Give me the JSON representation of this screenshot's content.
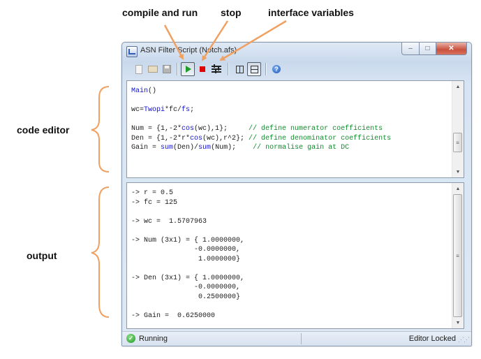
{
  "annotations": {
    "compile_and_run": "compile and run",
    "stop": "stop",
    "interface_variables": "interface variables",
    "code_editor": "code editor",
    "output": "output"
  },
  "window": {
    "title": "ASN Filter Script (Notch.afs)",
    "min_glyph": "–",
    "max_glyph": "□",
    "close_glyph": "✕"
  },
  "toolbar": {
    "help_glyph": "?"
  },
  "code_lines": [
    [
      {
        "t": "Main",
        "c": "blue"
      },
      {
        "t": "()"
      }
    ],
    [],
    [
      {
        "t": "wc="
      },
      {
        "t": "Twopi",
        "c": "blue"
      },
      {
        "t": "*fc/"
      },
      {
        "t": "fs",
        "c": "blue"
      },
      {
        "t": ";"
      }
    ],
    [],
    [
      {
        "t": "Num = {1,-2*"
      },
      {
        "t": "cos",
        "c": "blue"
      },
      {
        "t": "(wc),1};     "
      },
      {
        "t": "// define numerator coefficients",
        "c": "green"
      }
    ],
    [
      {
        "t": "Den = {1,-2*r*"
      },
      {
        "t": "cos",
        "c": "blue"
      },
      {
        "t": "(wc),r^2}; "
      },
      {
        "t": "// define denominator coefficients",
        "c": "green"
      }
    ],
    [
      {
        "t": "Gain = "
      },
      {
        "t": "sum",
        "c": "blue"
      },
      {
        "t": "(Den)/"
      },
      {
        "t": "sum",
        "c": "blue"
      },
      {
        "t": "(Num);    "
      },
      {
        "t": "// normalise gain at DC",
        "c": "green"
      }
    ]
  ],
  "output_lines": [
    "-> r = 0.5",
    "-> fc = 125",
    "",
    "-> wc =  1.5707963",
    "",
    "-> Num (3x1) = { 1.0000000,",
    "               -0.0000000,",
    "                1.0000000}",
    "",
    "-> Den (3x1) = { 1.0000000,",
    "               -0.0000000,",
    "                0.2500000}",
    "",
    "-> Gain =  0.6250000"
  ],
  "status": {
    "left": "Running",
    "right": "Editor Locked",
    "ok_glyph": "✓"
  },
  "colors": {
    "arrow": "#f0a060",
    "brace": "#f0a060",
    "keyword": "#1010d0",
    "comment": "#0f8a2c"
  }
}
